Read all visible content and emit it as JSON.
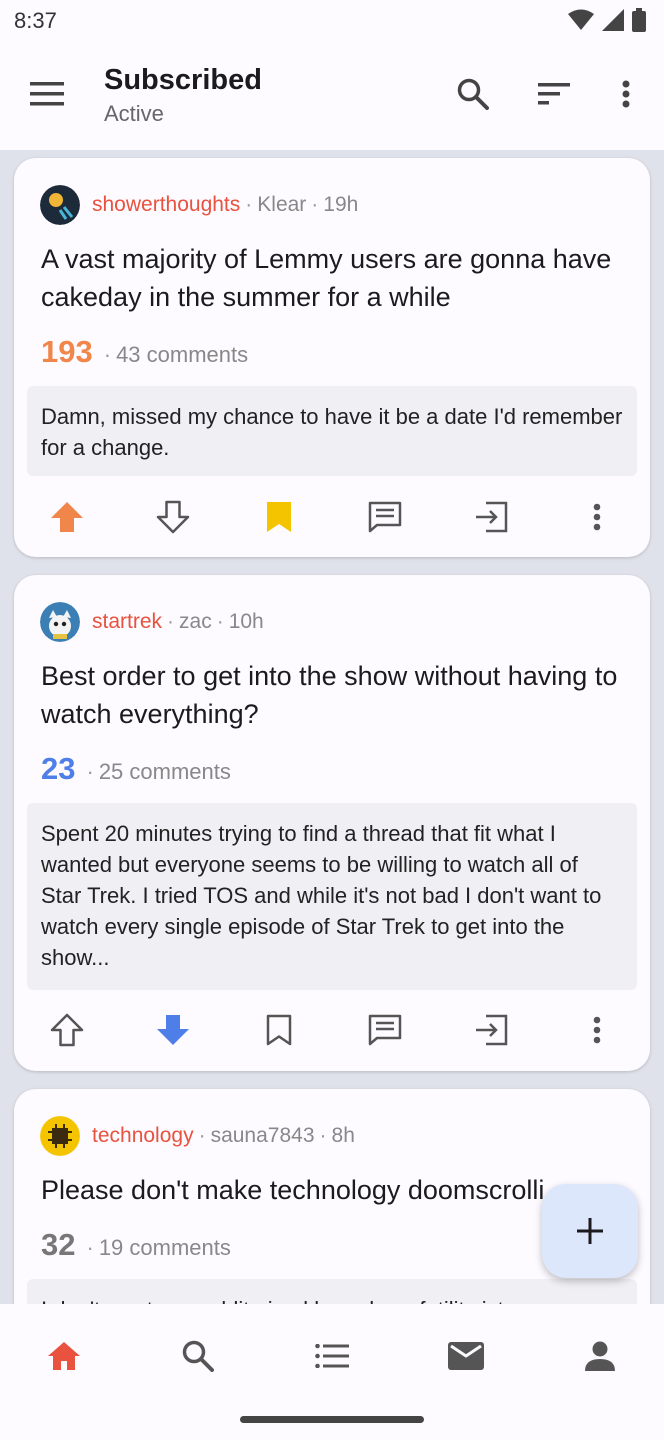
{
  "status": {
    "time": "8:37"
  },
  "header": {
    "title": "Subscribed",
    "subtitle": "Active"
  },
  "colors": {
    "accent": "#e8523e",
    "upvote": "#f0864a",
    "downvote": "#4e7fe8",
    "saved": "#f5c400"
  },
  "posts": [
    {
      "community": "showerthoughts",
      "author": "Klear",
      "age": "19h",
      "title": "A vast majority of Lemmy users are gonna have cakeday in the summer for a while",
      "score": "193",
      "comments": "43 comments",
      "body": "Damn, missed my chance to have it be a date I'd remember for a change.",
      "vote": "up",
      "saved": true
    },
    {
      "community": "startrek",
      "author": "zac",
      "age": "10h",
      "title": "Best order to get into the show without having to watch everything?",
      "score": "23",
      "comments": "25 comments",
      "body": "Spent 20 minutes trying to find a thread that fit what I wanted but everyone seems to be willing to watch all of Star Trek. I tried TOS and while it's not bad I don't want to watch every single episode of Star Trek to get into the show...",
      "vote": "down",
      "saved": false
    },
    {
      "community": "technology",
      "author": "sauna7843",
      "age": "8h",
      "title": "Please don't make technology doomscrolli",
      "score": "32",
      "comments": "19 comments",
      "body": "I don't want my reddit-sized bee-sharp futility ist",
      "vote": "none",
      "saved": false
    }
  ],
  "icons": {
    "menu": "menu-icon",
    "search": "search-icon",
    "sort": "sort-icon",
    "more": "more-vert-icon",
    "upvote": "arrow-up-icon",
    "downvote": "arrow-down-icon",
    "save": "bookmark-icon",
    "comments": "comment-icon",
    "open": "open-in-icon",
    "fab": "plus-icon"
  },
  "bottom_nav": [
    "home",
    "search",
    "communities",
    "inbox",
    "profile"
  ]
}
